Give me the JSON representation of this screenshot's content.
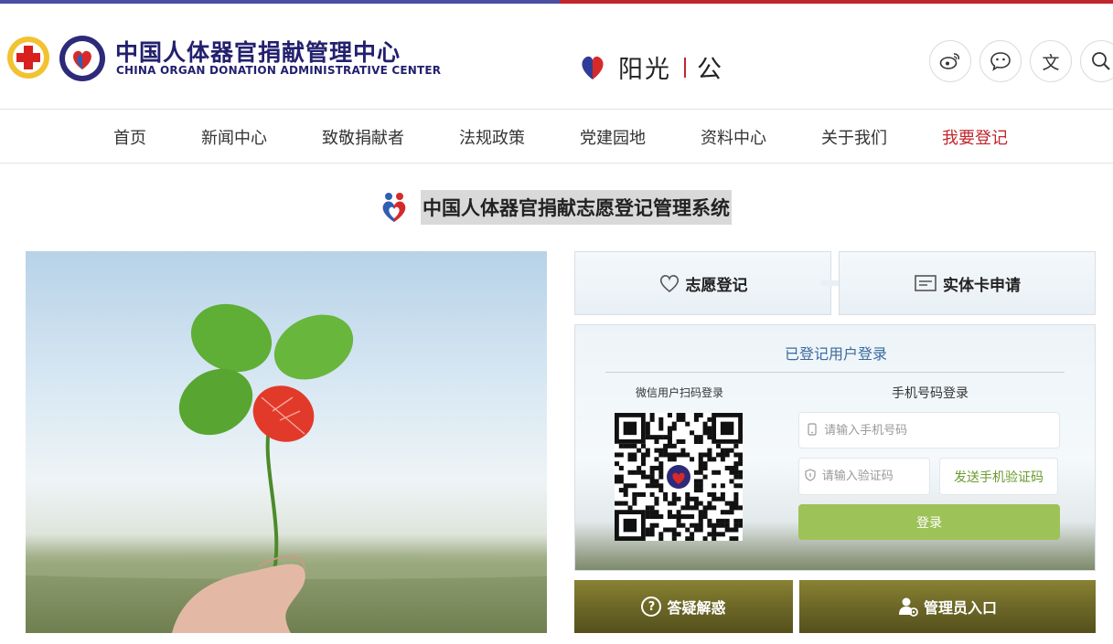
{
  "colors": {
    "brand_blue": "#23206e",
    "brand_red": "#c0272d",
    "login_green": "#9dc257",
    "send_code_green": "#6a9a2e",
    "olive": "#6f6a28"
  },
  "header": {
    "org_name_cn": "中国人体器官捐献管理中心",
    "org_name_en": "CHINA ORGAN DONATION ADMINISTRATIVE CENTER",
    "slogan_left": "阳光",
    "slogan_right": "公",
    "icons": [
      "weibo-icon",
      "wechat-icon",
      "language-icon",
      "search-icon"
    ],
    "language_glyph": "文"
  },
  "nav": {
    "items": [
      {
        "label": "首页"
      },
      {
        "label": "新闻中心"
      },
      {
        "label": "致敬捐献者"
      },
      {
        "label": "法规政策"
      },
      {
        "label": "党建园地"
      },
      {
        "label": "资料中心"
      },
      {
        "label": "关于我们"
      },
      {
        "label": "我要登记",
        "active": true
      }
    ]
  },
  "system_title": "中国人体器官捐献志愿登记管理系统",
  "tabs": {
    "volunteer": "志愿登记",
    "card": "实体卡申请"
  },
  "login": {
    "title": "已登记用户登录",
    "qr_label": "微信用户扫码登录",
    "phone_label": "手机号码登录",
    "phone_placeholder": "请输入手机号码",
    "code_placeholder": "请输入验证码",
    "send_code": "发送手机验证码",
    "submit": "登录"
  },
  "bottom": {
    "faq": "答疑解惑",
    "faq_glyph": "?",
    "admin": "管理员入口"
  }
}
